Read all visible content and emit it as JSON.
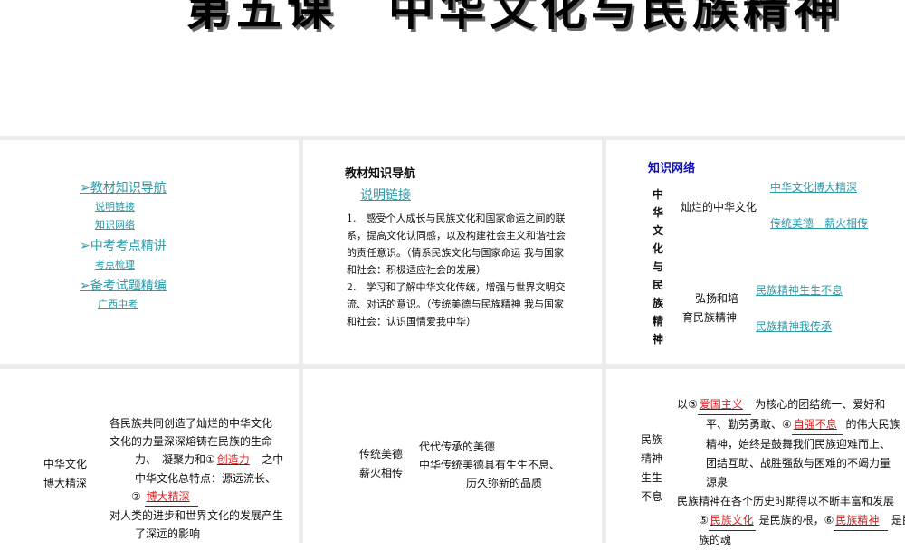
{
  "title": "第五课　中华文化与民族精神",
  "nav": {
    "items": [
      {
        "label": "教材知识导航",
        "subs": [
          "说明链接",
          "知识网络"
        ]
      },
      {
        "label": "中考考点精讲",
        "subs": [
          "考点梳理"
        ]
      },
      {
        "label": "备考试题精编",
        "subs": [
          "广西中考"
        ]
      }
    ]
  },
  "guide": {
    "heading": "教材知识导航",
    "link": "说明链接",
    "lines": [
      "1.　感受个人成长与民族文化和国家命运之间的联",
      "系，提高文化认同感，以及构建社会主义和谐社会",
      "的责任意识。（情系民族文化与国家命运 我与国家",
      "和社会：积极适应社会的发展）",
      "2.　学习和了解中华文化传统，增强与世界文明交",
      "流、对话的意识。（传统美德与民族精神 我与国家",
      "和社会：认识国情爱我中华）"
    ]
  },
  "network": {
    "heading": "知识网络",
    "root": [
      "中",
      "华",
      "文",
      "化",
      "与",
      "民",
      "族",
      "精",
      "神"
    ],
    "branch1": "灿烂的中华文化",
    "branch1_items": [
      "中华文化博大精深",
      "传统美德　薪火相传"
    ],
    "branch2": [
      "弘扬和培",
      "育民族精神"
    ],
    "branch2_items": [
      "民族精神生生不息",
      "民族精神我传承"
    ]
  },
  "culture": {
    "label": [
      "中华文化",
      "博大精深"
    ],
    "l1": "各民族共同创造了灿烂的中华文化",
    "l2": "文化的力量深深熔铸在民族的生命",
    "l3a": "力、　凝聚力和①",
    "ans1": "创造力",
    "l3b": "之中",
    "l4": "中华文化总特点：源远流长、",
    "l5a": "②",
    "ans2": "博大精深",
    "l6": "对人类的进步和世界文化的发展产生",
    "l7": "了深远的影响"
  },
  "virtue": {
    "label": [
      "传统美德",
      "薪火相传"
    ],
    "l1": "代代传承的美德",
    "l2": "中华传统美德具有生生不息、",
    "l3": "历久弥新的品质"
  },
  "spirit": {
    "label": [
      "民族",
      "精神",
      "生生",
      "不息"
    ],
    "l1a": "以③",
    "ans3": "爱国主义",
    "l1b": "为核心的团结统一、爱好和",
    "l2a": "平、勤劳勇敢、④",
    "ans4": "自强不息",
    "l2b": "的伟大民族",
    "l3": "精神，始终是鼓舞我们民族迎难而上、",
    "l4": "团结互助、战胜强敌与困难的不竭力量",
    "l5": "源泉",
    "l6": "民族精神在各个历史时期得以不断丰富和发展",
    "l7a": "⑤",
    "ans5": "民族文化",
    "l7b": "是民族的根，⑥",
    "ans6": "民族精神",
    "l7c": "是民",
    "l8": "族的魂"
  }
}
